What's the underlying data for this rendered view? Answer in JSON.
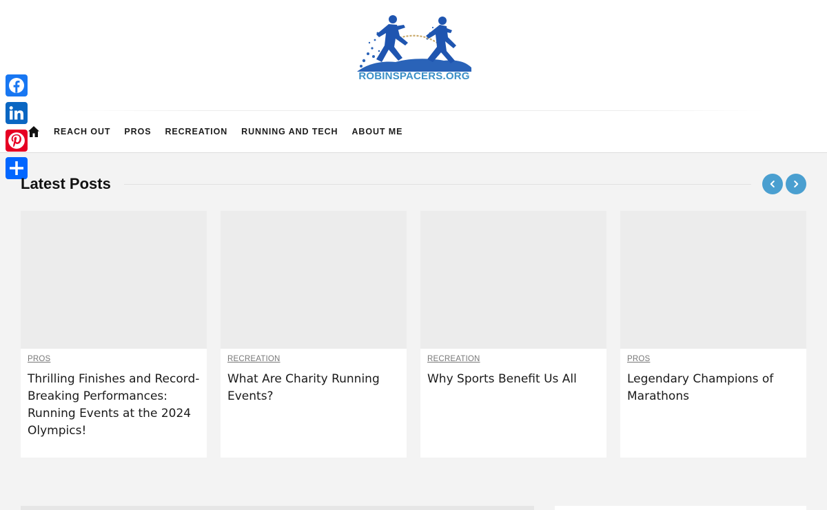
{
  "site": {
    "logo_text": "ROBINSPACERS.ORG",
    "logo_icon": "runners-logo",
    "brand_color": "#3a8fc7"
  },
  "nav": {
    "home_icon": "home-icon",
    "items": [
      "REACH OUT",
      "PROS",
      "RECREATION",
      "RUNNING AND TECH",
      "ABOUT ME"
    ]
  },
  "share": {
    "buttons": [
      {
        "icon": "facebook-icon",
        "color": "#1877f2"
      },
      {
        "icon": "linkedin-icon",
        "color": "#0a66c2"
      },
      {
        "icon": "pinterest-icon",
        "color": "#e60023"
      },
      {
        "icon": "share-plus-icon",
        "color": "#0166ff"
      }
    ]
  },
  "latest": {
    "title": "Latest Posts",
    "prev_icon": "chevron-left-icon",
    "next_icon": "chevron-right-icon",
    "accent": "#4a9fd0",
    "posts": [
      {
        "category": "PROS",
        "title": "Thrilling Finishes and Record-Breaking Performances: Running Events at the 2024 Olympics!"
      },
      {
        "category": "RECREATION",
        "title": "What Are Charity Running Events?"
      },
      {
        "category": "RECREATION",
        "title": "Why Sports Benefit Us All"
      },
      {
        "category": "PROS",
        "title": "Legendary Champions of Marathons"
      }
    ]
  }
}
